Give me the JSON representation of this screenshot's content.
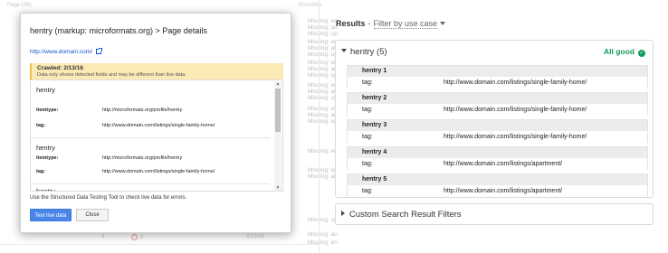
{
  "background": {
    "column_headers": [
      "Page URL",
      "Errors",
      "Sta"
    ],
    "missing_rows": [
      "Missing: en",
      "Missing: au",
      "Missing: up",
      "Missing: en",
      "Missing: au",
      "Missing: up",
      "Missing: en",
      "Missing: au",
      "Missing: up",
      "Missing: en",
      "Missing: au",
      "Missing: up",
      "Missing: en",
      "Missing: au",
      "Missing: up",
      "Missing: en",
      "Missing: en",
      "Missing: au",
      "Missing: up",
      "Missing: au",
      "Missing: en"
    ],
    "bottom_left": "4",
    "bottom_error": "2",
    "bottom_date": "2/13/16"
  },
  "modal": {
    "title": "hentry (markup: microformats.org) > Page details",
    "url": "http://www.domain.com/",
    "crawled": "Crawled: 2/13/16",
    "crawled_note": "Data only shows detected fields and may be different than live data.",
    "entries": [
      {
        "name": "hentry",
        "props": [
          {
            "key": "itemtype:",
            "value": "http://microformats.org/profile/hentry"
          },
          {
            "key": "tag:",
            "value": "http://www.domain.com/listings/single-family-home/"
          }
        ]
      },
      {
        "name": "hentry",
        "props": [
          {
            "key": "itemtype:",
            "value": "http://microformats.org/profile/hentry"
          },
          {
            "key": "tag:",
            "value": "http://www.domain.com/listings/single-family-home/"
          }
        ]
      },
      {
        "name": "hentry",
        "props": []
      }
    ],
    "footer_text": "Use the Structured Data Testing Tool to check live data for errors.",
    "test_button": "Test live data",
    "close_button": "Close"
  },
  "results": {
    "label": "Results",
    "separator": "-",
    "filter_link": "Filter by use case",
    "group": {
      "title": "hentry (5)",
      "status": "All good",
      "items": [
        {
          "name": "hentry 1",
          "key": "tag:",
          "value": "http://www.domain.com/listings/single-family-home/"
        },
        {
          "name": "hentry 2",
          "key": "tag:",
          "value": "http://www.domain.com/listings/single-family-home/"
        },
        {
          "name": "hentry 3",
          "key": "tag:",
          "value": "http://www.domain.com/listings/single-family-home/"
        },
        {
          "name": "hentry 4",
          "key": "tag:",
          "value": "http://www.domain.com/listings/apartment/"
        },
        {
          "name": "hentry 5",
          "key": "tag:",
          "value": "http://www.domain.com/listings/apartment/"
        }
      ]
    },
    "filters_title": "Custom Search Result Filters"
  },
  "colors": {
    "good": "#0f9d58",
    "link": "#1155cc",
    "primary_button": "#4a86e8",
    "crawl_notice": "#fbe9b6"
  },
  "icons": [
    "external-link-icon",
    "caret-down-icon",
    "expand-triangle-icon",
    "collapse-triangle-icon",
    "check-circle-icon",
    "error-icon"
  ]
}
